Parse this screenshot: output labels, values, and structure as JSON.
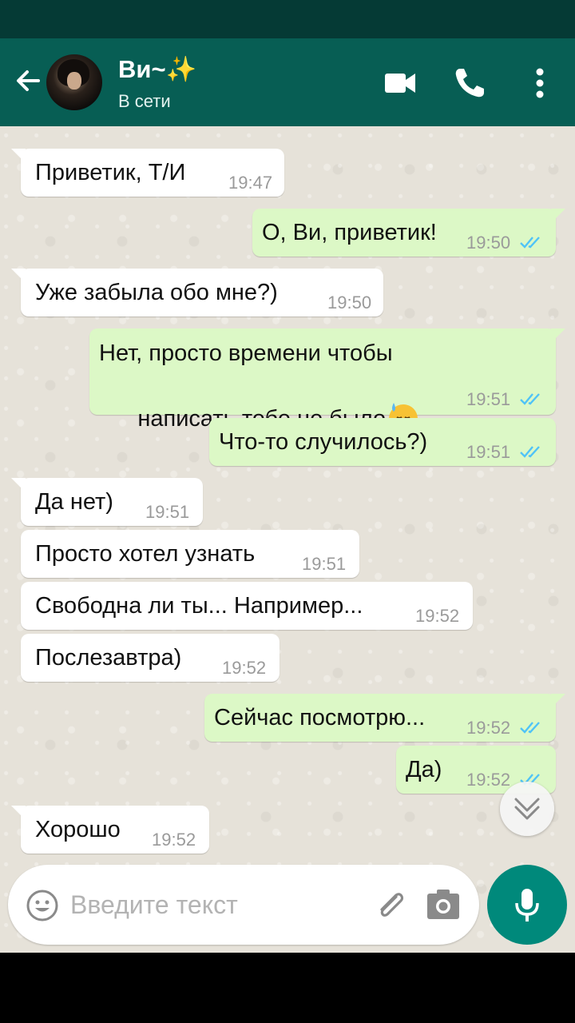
{
  "header": {
    "contact_name": "Ви~",
    "contact_name_emoji": "✨",
    "contact_status": "В сети",
    "icons": [
      "back-arrow-icon",
      "video-call-icon",
      "phone-call-icon",
      "more-options-icon"
    ]
  },
  "messages": [
    {
      "dir": "in",
      "text": "Приветик, Т/И",
      "time": "19:47"
    },
    {
      "dir": "out",
      "text": "О, Ви, приветик!",
      "time": "19:50",
      "read": true
    },
    {
      "dir": "in",
      "text": "Уже забыла обо мне?)",
      "time": "19:50"
    },
    {
      "dir": "out",
      "text_line1": "Нет, просто времени чтобы",
      "text_line2": "написать тебе не было",
      "emoji": "downcast-face-with-sweat",
      "time": "19:51",
      "read": true
    },
    {
      "dir": "out",
      "text": "Что-то случилось?)",
      "time": "19:51",
      "read": true
    },
    {
      "dir": "in",
      "text": "Да нет)",
      "time": "19:51"
    },
    {
      "dir": "in",
      "text": "Просто хотел узнать",
      "time": "19:51"
    },
    {
      "dir": "in",
      "text": "Свободна ли ты... Например...",
      "time": "19:52"
    },
    {
      "dir": "in",
      "text": "Послезавтра)",
      "time": "19:52"
    },
    {
      "dir": "out",
      "text": "Сейчас посмотрю...",
      "time": "19:52",
      "read": true
    },
    {
      "dir": "out",
      "text": "Да)",
      "time": "19:52",
      "read": true
    },
    {
      "dir": "in",
      "text": "Хорошо",
      "time": "19:52"
    }
  ],
  "composer": {
    "placeholder": "Введите текст",
    "icons": [
      "emoji-icon",
      "attach-icon",
      "camera-icon",
      "mic-icon"
    ]
  },
  "colors": {
    "header": "#075e54",
    "statusbar": "#053a35",
    "incoming_bubble": "#ffffff",
    "outgoing_bubble": "#dcf8c6",
    "read_ticks": "#4fc3f7",
    "mic_button": "#00897b"
  }
}
